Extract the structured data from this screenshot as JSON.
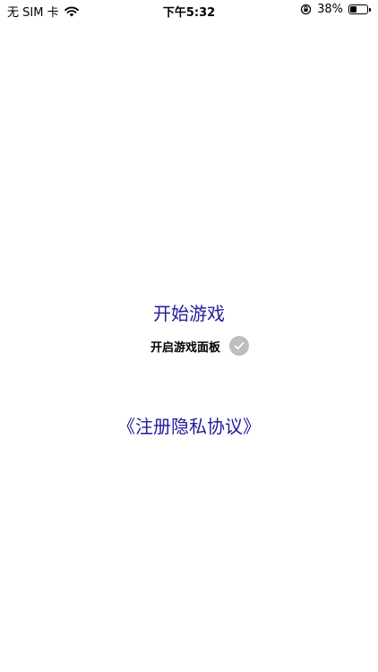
{
  "status_bar": {
    "carrier": "无 SIM 卡",
    "time": "下午5:32",
    "battery_percent_text": "38%",
    "battery_level": 0.38,
    "icons": [
      "wifi-icon",
      "lock-rotation-icon",
      "battery-icon"
    ]
  },
  "main": {
    "start_game_label": "开始游戏",
    "panel_toggle_label": "开启游戏面板",
    "panel_toggle_icon": "check-icon",
    "panel_toggle_color": "#bdbdbd",
    "privacy_link_label": "《注册隐私协议》",
    "link_color": "#231b9b"
  }
}
